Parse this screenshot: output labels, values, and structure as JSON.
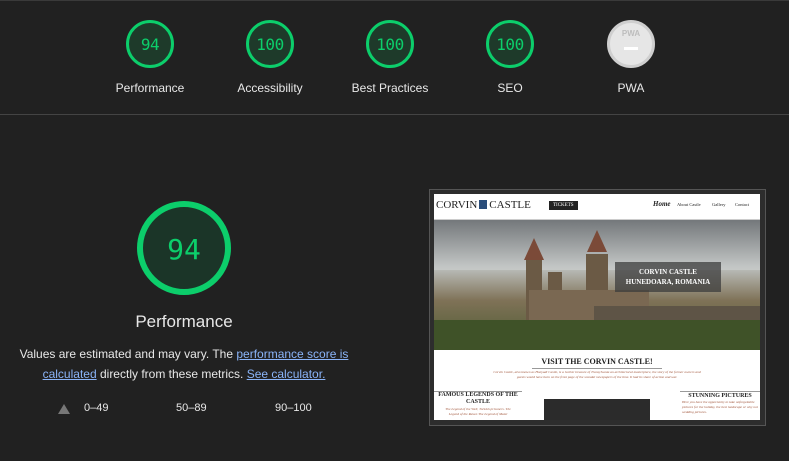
{
  "gauges": [
    {
      "label": "Performance",
      "score": "94"
    },
    {
      "label": "Accessibility",
      "score": "100"
    },
    {
      "label": "Best Practices",
      "score": "100"
    },
    {
      "label": "SEO",
      "score": "100"
    },
    {
      "label": "PWA",
      "score": "PWA"
    }
  ],
  "performance": {
    "score": "94",
    "title": "Performance",
    "note_prefix": "Values are estimated and may vary. The ",
    "note_link1": "performance score is calculated",
    "note_middle": " directly from these metrics. ",
    "note_link2": "See calculator."
  },
  "legend": {
    "fail": "0–49",
    "average": "50–89",
    "pass": "90–100"
  },
  "colors": {
    "pass": "#0cce6b",
    "link": "#8ab4f8",
    "background": "#212121"
  },
  "screenshot": {
    "logo": "CORVIN",
    "logo2": "CASTLE",
    "tickets": "TICKETS",
    "nav": [
      "Home",
      "About Castle",
      "Gallery",
      "Contact"
    ],
    "hero_line1": "CORVIN CASTLE",
    "hero_line2": "HUNEDOARA, ROMANIA",
    "visit_title": "VISIT THE CORVIN CASTLE!",
    "visit_text": "Corvin Castle, also known as Hunyadi Castle, is a Gothic treasure of Transylvania an architectural masterpiece, the story of the former owners and guests would have been on the front page of the scandal newspapers of the time. It had its share of action and war.",
    "legends_title": "FAMOUS LEGENDS OF THE CASTLE",
    "legends_text": "The Legend of the Well, Turkish prisoners. The Legend of the Raven The Legend of Matei",
    "pictures_title": "STUNNING PICTURES",
    "pictures_text": "Here you have the opportunity to take unforgettable pictures for the holiday, the best landscape or why not wedding pictures."
  }
}
